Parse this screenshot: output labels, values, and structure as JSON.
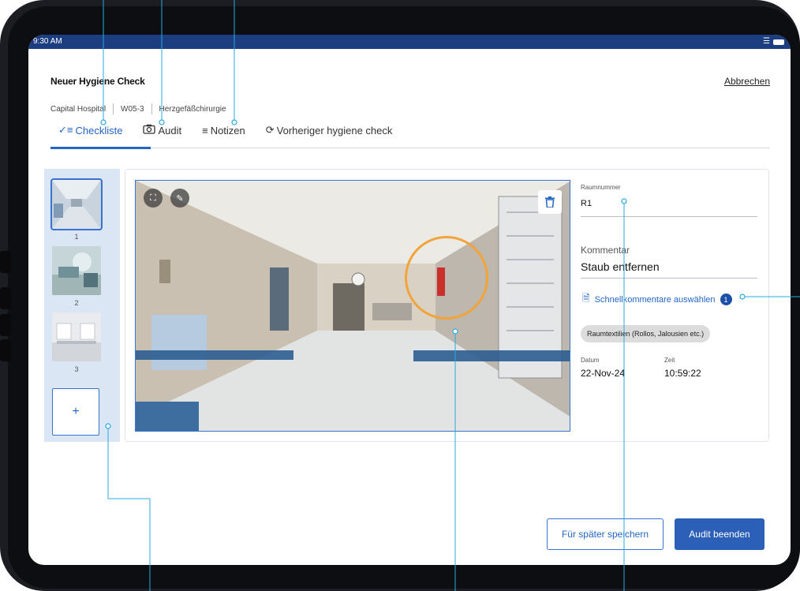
{
  "status": {
    "time": "9:30 AM"
  },
  "header": {
    "title": "Neuer Hygiene Check",
    "cancel_label": "Abbrechen"
  },
  "breadcrumbs": [
    "Capital Hospital",
    "W05-3",
    "Herzgefäßchirurgie"
  ],
  "tabs": [
    {
      "label": "Checkliste",
      "icon": "checklist-icon",
      "active": true
    },
    {
      "label": "Audit",
      "icon": "camera-icon",
      "active": false
    },
    {
      "label": "Notizen",
      "icon": "notes-icon",
      "active": false
    },
    {
      "label": "Vorheriger hygiene check",
      "icon": "history-icon",
      "active": false
    }
  ],
  "thumbnails": [
    {
      "number": "1",
      "selected": true
    },
    {
      "number": "2",
      "selected": false
    },
    {
      "number": "3",
      "selected": false
    }
  ],
  "add_label": "+",
  "form": {
    "room_label": "Raumnummer",
    "room_value": "R1",
    "comment_label": "Kommentar",
    "comment_value": "Staub entfernen",
    "quick_comments_label": "Schnellkommentare auswählen",
    "quick_comments_count": "1",
    "tag": "Raumtextilien (Rollos, Jalousien etc.)",
    "date_label": "Datum",
    "date_value": "22-Nov-24",
    "time_label": "Zeit",
    "time_value": "10:59:22"
  },
  "actions": {
    "save_later": "Für später speichern",
    "finish": "Audit beenden"
  },
  "colors": {
    "primary": "#2366c4",
    "status_bar": "#1c3d80",
    "thumb_panel": "#dbe6f5",
    "highlight_ring": "#f2a33a",
    "annotation": "#29a9e0"
  }
}
